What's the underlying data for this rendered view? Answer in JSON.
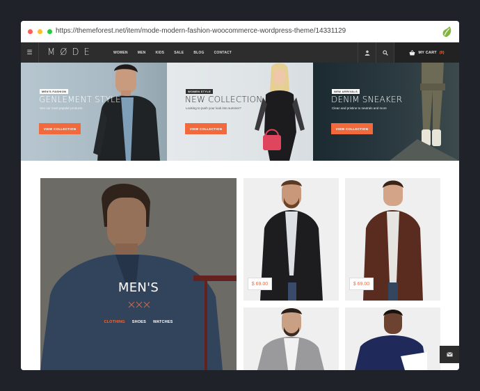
{
  "browser": {
    "url": "https://themeforest.net/item/mode-modern-fashion-woocommerce-wordpress-theme/14331129"
  },
  "nav": {
    "logo": "MØDE",
    "links": [
      "WOMEN",
      "MEN",
      "KIDS",
      "SALE",
      "BLOG",
      "CONTACT"
    ],
    "cart_label": "MY CART",
    "cart_count": "(0)"
  },
  "banners": [
    {
      "tag": "MEN'S FASHION",
      "title": "GENLEMENT STYLE",
      "subtitle": "See our most popular products",
      "button": "VIEW COLLECTION"
    },
    {
      "tag": "WOMEN STYLE",
      "title": "NEW COLLECTION",
      "subtitle": "Looking to push your look into summer?",
      "button": "VIEW COLLECTION"
    },
    {
      "tag": "NEW ARRIVALS",
      "title": "DENIM SNEAKER",
      "subtitle": "Clean and pristine to neutrals and more",
      "button": "VIEW COLLECTION"
    }
  ],
  "category": {
    "title": "MEN'S",
    "links": [
      "CLOTHING",
      "SHOES",
      "WATCHES"
    ]
  },
  "products": [
    {
      "price": "$ 69.00"
    },
    {
      "price": "$ 69.00"
    }
  ],
  "colors": {
    "accent": "#f26a3b",
    "nav_bg": "#2d2d2d",
    "page_bg": "#1f2329"
  }
}
